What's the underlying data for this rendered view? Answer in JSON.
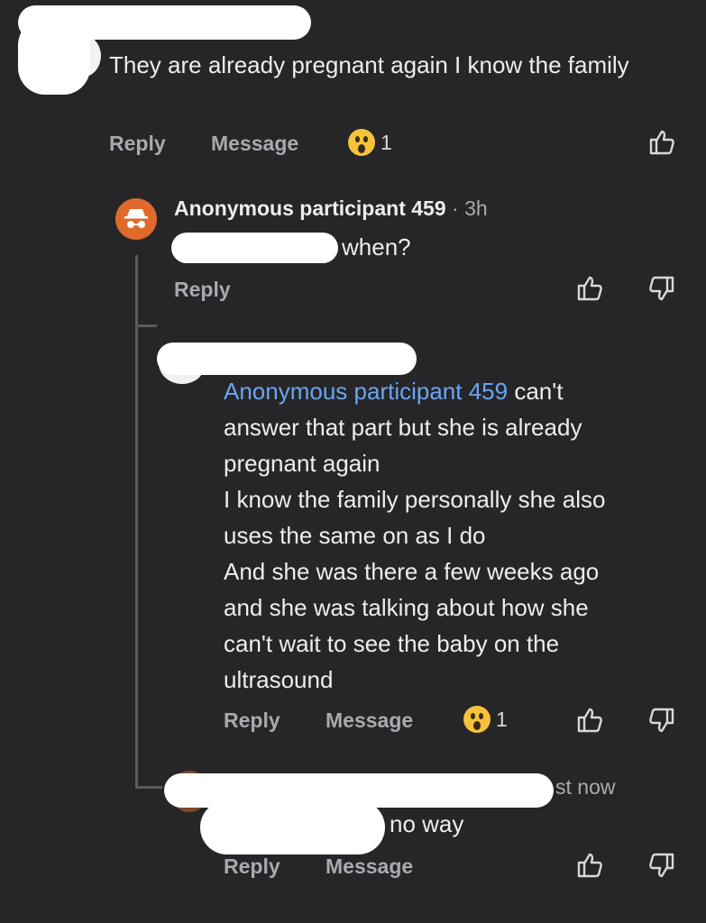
{
  "comment1": {
    "text": "They are already pregnant again I know the family",
    "actions": {
      "reply": "Reply",
      "message": "Message"
    },
    "reaction_count": "1"
  },
  "reply1": {
    "author": "Anonymous participant 459",
    "meta": "· 3h",
    "text": "when?",
    "actions": {
      "reply": "Reply"
    }
  },
  "reply2": {
    "mention": "Anonymous participant 459",
    "lines": [
      "can't",
      "answer that part but she is already",
      "pregnant again",
      "I know the family personally she also",
      "uses the same on as I do",
      "And she was there a few weeks ago",
      "and she was talking about how she",
      "can't wait to see the baby on the",
      "ultrasound"
    ],
    "actions": {
      "reply": "Reply",
      "message": "Message"
    },
    "reaction_count": "1"
  },
  "reply3": {
    "meta": "st now",
    "text": "no way",
    "actions": {
      "reply": "Reply",
      "message": "Message"
    }
  },
  "colors": {
    "background": "#262629",
    "mention": "#6aa5f0",
    "avatar_anon": "#e06a2c"
  },
  "icons": [
    "thumbs-up-icon",
    "thumbs-down-icon",
    "shocked-face-emoji",
    "incognito-avatar-icon"
  ]
}
